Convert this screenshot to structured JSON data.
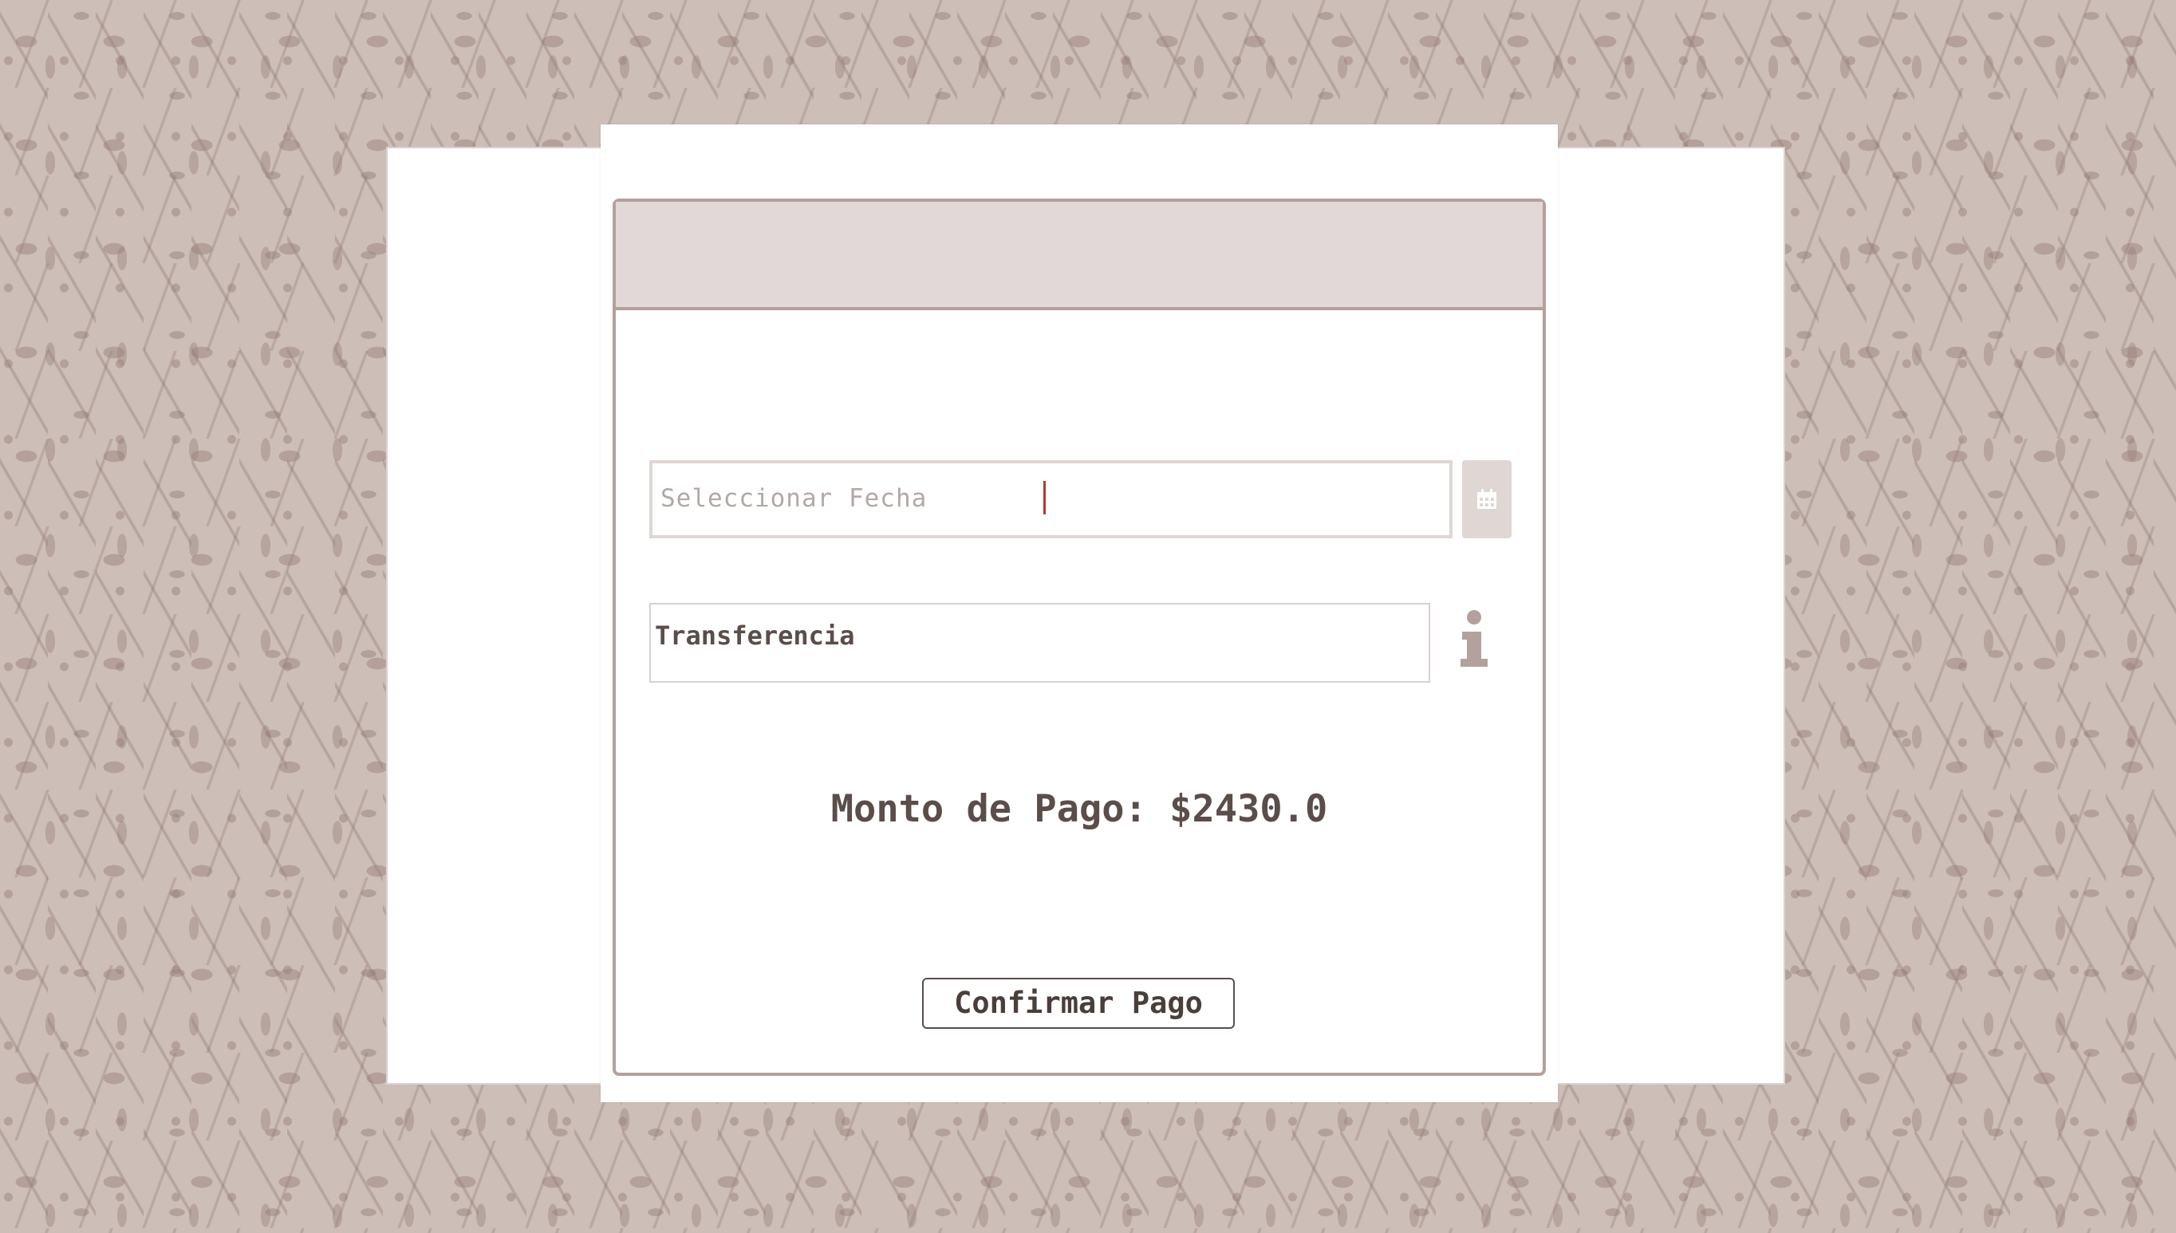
{
  "payment_form": {
    "date_field": {
      "placeholder": "Seleccionar Fecha",
      "icon": "calendar-icon"
    },
    "payment_method": {
      "value": "Transferencia",
      "icon": "info-icon"
    },
    "amount_text": "Monto de Pago: $2430.0",
    "confirm_label": "Confirmar Pago"
  },
  "colors": {
    "accent": "#b4a09c",
    "header_fill": "#e2d8d7",
    "text": "#5a4d4a",
    "cursor": "#b23a2a",
    "background_pattern": "#cdbeb8"
  }
}
